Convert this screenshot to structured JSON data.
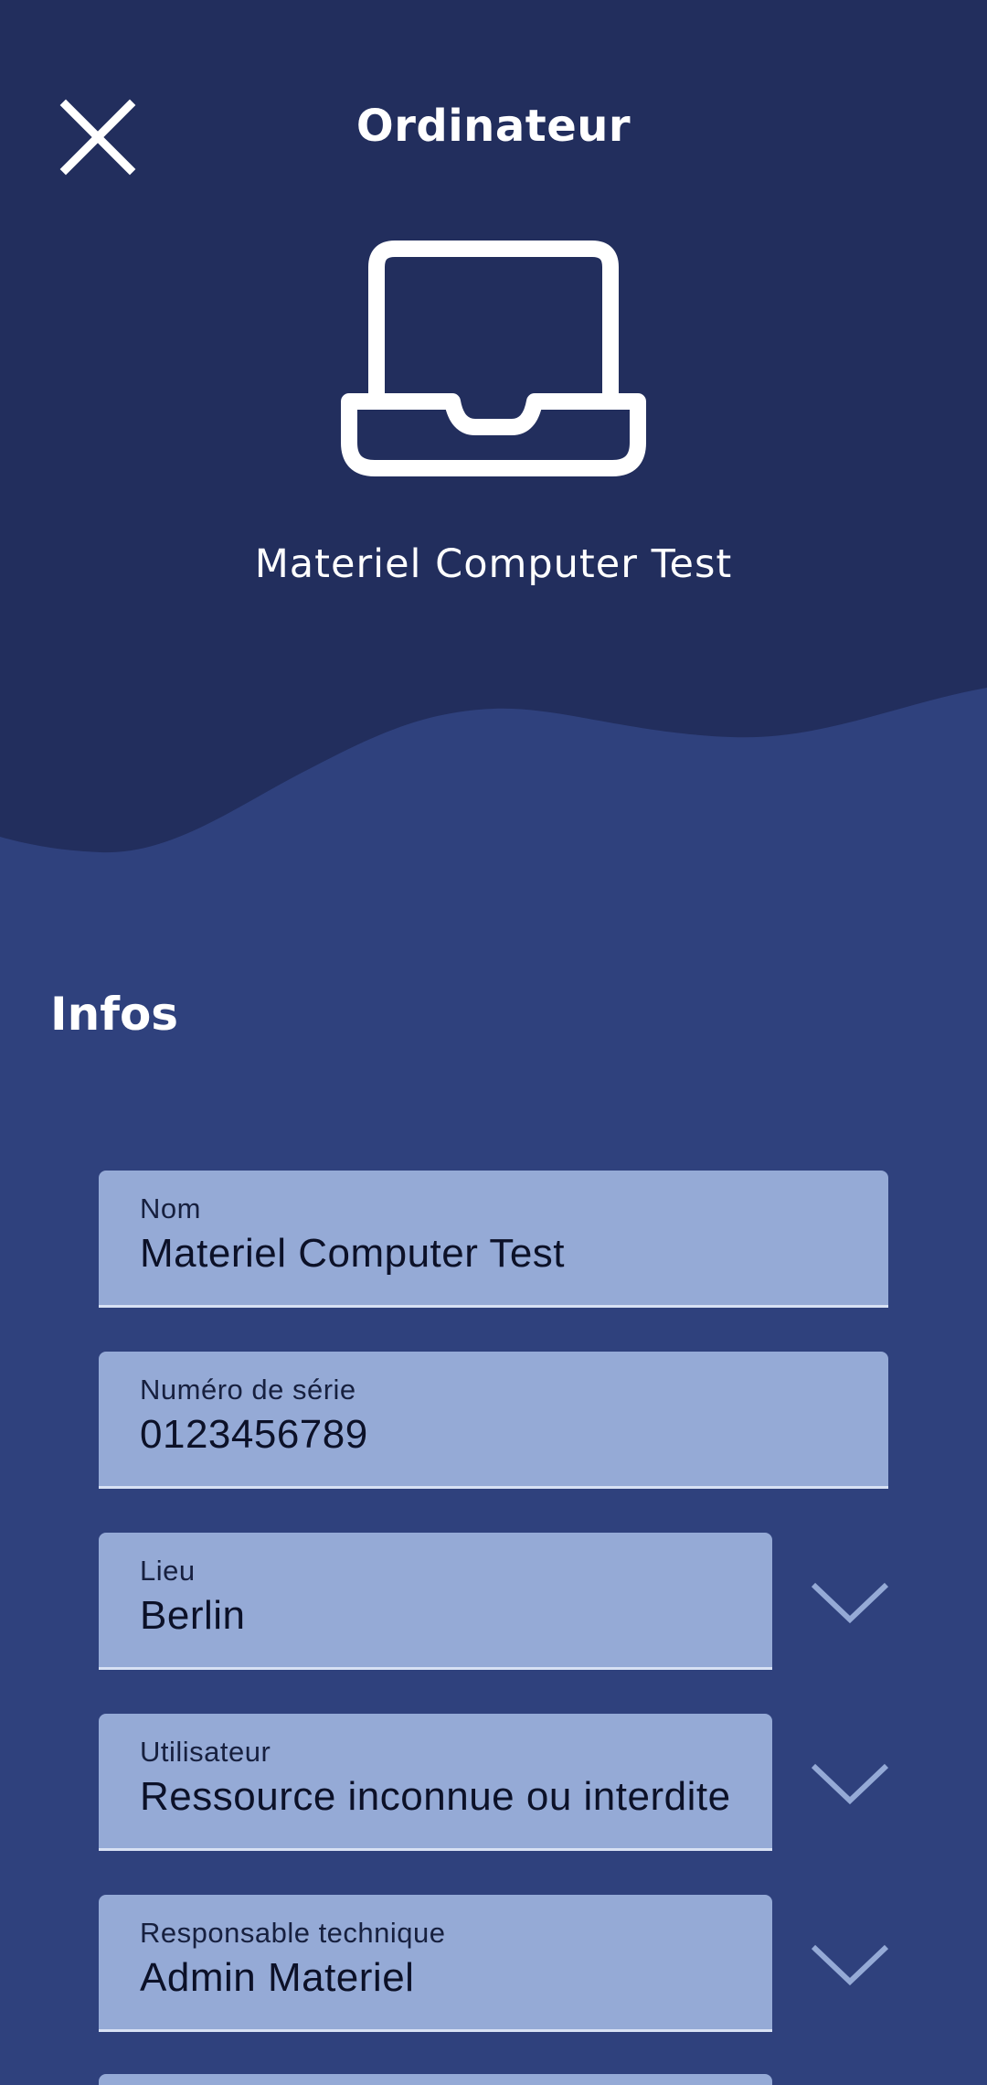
{
  "header": {
    "title": "Ordinateur",
    "device_name": "Materiel Computer Test",
    "icon": "laptop-icon",
    "close_icon": "close-icon"
  },
  "section": {
    "title": "Infos"
  },
  "fields": [
    {
      "label": "Nom",
      "value": "Materiel Computer Test",
      "has_dropdown": false
    },
    {
      "label": "Numéro de série",
      "value": "0123456789",
      "has_dropdown": false
    },
    {
      "label": "Lieu",
      "value": "Berlin",
      "has_dropdown": true
    },
    {
      "label": "Utilisateur",
      "value": "Ressource inconnue ou interdite",
      "has_dropdown": true
    },
    {
      "label": "Responsable technique",
      "value": "Admin Materiel",
      "has_dropdown": true
    }
  ],
  "colors": {
    "header_bg": "#222e5d",
    "body_bg": "#2f417d",
    "field_bg": "#95aad6",
    "chevron": "#95aad6"
  }
}
